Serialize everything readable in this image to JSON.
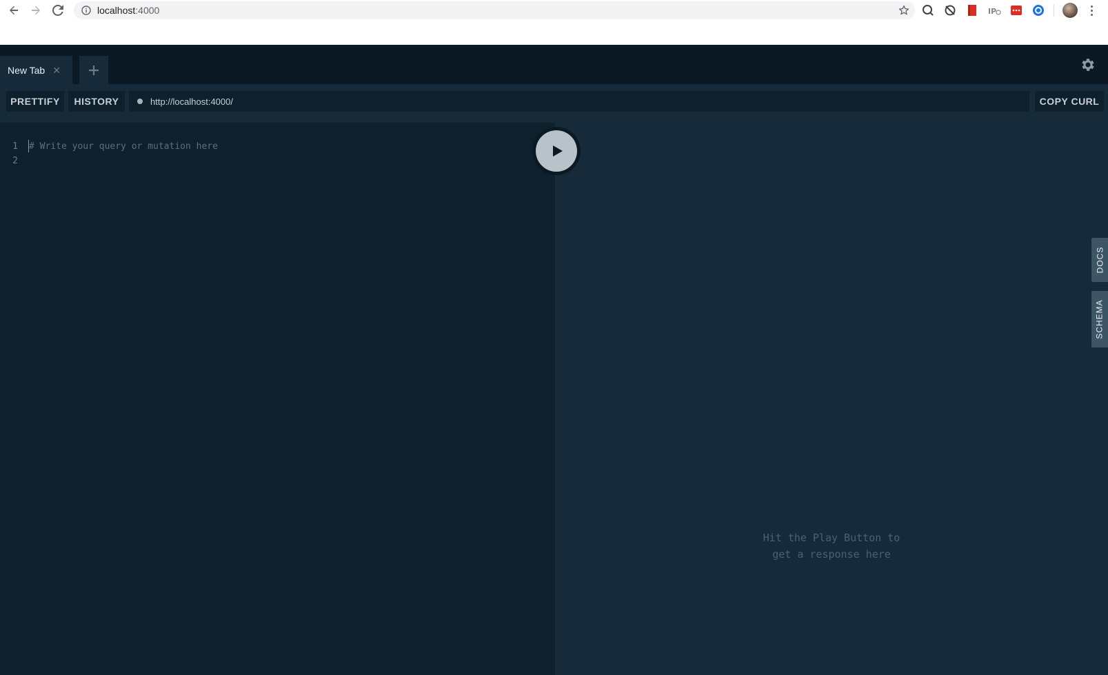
{
  "browser": {
    "url_host": "localhost",
    "url_port": ":4000"
  },
  "tabs": [
    {
      "label": "New Tab"
    }
  ],
  "toolbar": {
    "prettify_label": "PRETTIFY",
    "history_label": "HISTORY",
    "endpoint_url": "http://localhost:4000/",
    "copy_curl_label": "COPY CURL"
  },
  "editor": {
    "lines": [
      {
        "number": "1",
        "text": "# Write your query or mutation here"
      },
      {
        "number": "2",
        "text": ""
      }
    ]
  },
  "results": {
    "placeholder_line1": "Hit the Play Button to",
    "placeholder_line2": "get a response here"
  },
  "side_tabs": {
    "docs_label": "DOCS",
    "schema_label": "SCHEMA"
  },
  "colors": {
    "tabbar_bg": "#0b1924",
    "editor_bg": "#0f202d",
    "results_bg": "#172a3a",
    "side_tab_bg": "#3e5565"
  }
}
